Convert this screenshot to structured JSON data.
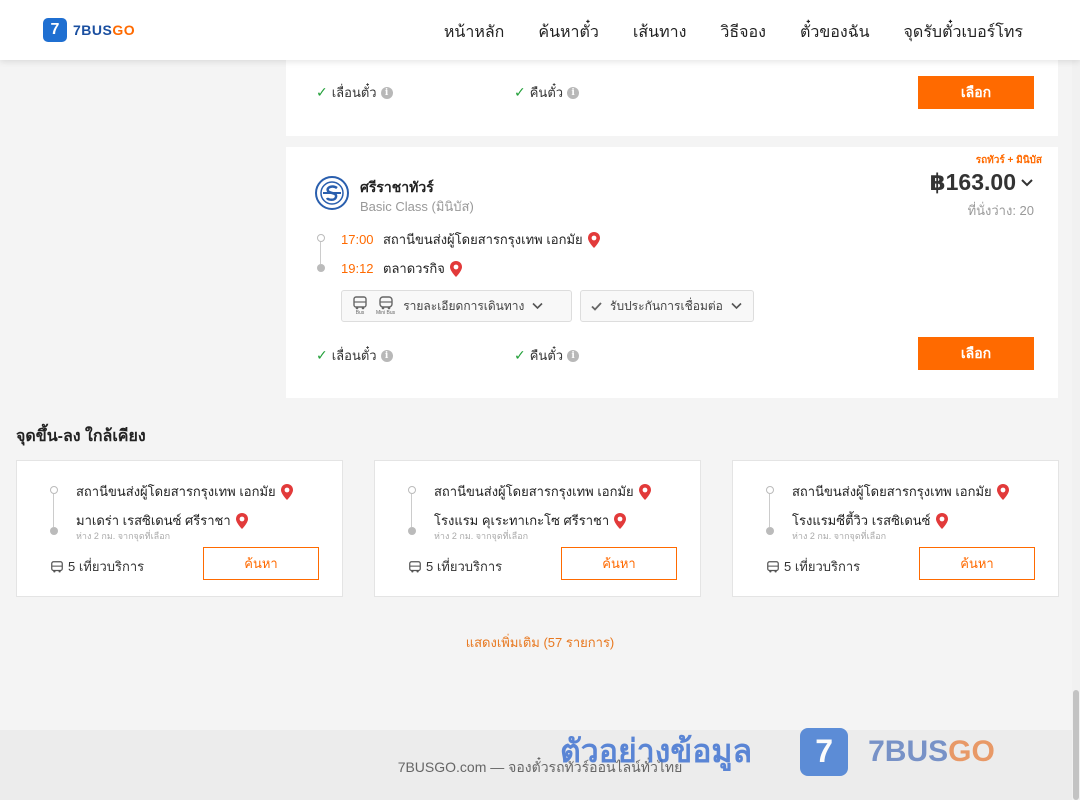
{
  "header": {
    "logo_digit": "7",
    "logo_word1": "7BUS",
    "logo_word2": "GO",
    "nav": [
      "หน้าหลัก",
      "ค้นหาตั๋ว",
      "เส้นทาง",
      "วิธีจอง",
      "ตั๋วของฉัน",
      "จุดรับตั๋วเบอร์โทร"
    ]
  },
  "card1": {
    "feature_reschedule": "เลื่อนตั๋ว",
    "feature_refund": "คืนตั๋ว",
    "select_label": "เลือก"
  },
  "card2": {
    "tag": "รถทัวร์ + มินิบัส",
    "operator": "ศรีราชาทัวร์",
    "class": "Basic Class (มินิบัส)",
    "price": "฿163.00",
    "seats": "ที่นั่งว่าง: 20",
    "depart_time": "17:00",
    "depart_station": "สถานีขนส่งผู้โดยสารกรุงเทพ เอกมัย",
    "arrive_time": "19:12",
    "arrive_station": "ตลาดวรกิจ",
    "bus_label": "Bus",
    "minibus_label": "Mini Bus",
    "details_label": "รายละเอียดการเดินทาง",
    "guarantee_label": "รับประกันการเชื่อมต่อ",
    "feature_reschedule": "เลื่อนตั๋ว",
    "feature_refund": "คืนตั๋ว",
    "select_label": "เลือก"
  },
  "nearby": {
    "title": "จุดขึ้น-ลง ใกล้เคียง",
    "cards": [
      {
        "from": "สถานีขนส่งผู้โดยสารกรุงเทพ เอกมัย",
        "to": "มาเดร่า เรสซิเดนซ์ ศรีราชา",
        "distance": "ห่าง 2 กม. จากจุดที่เลือก",
        "trips": "5 เที่ยวบริการ",
        "button": "ค้นหา"
      },
      {
        "from": "สถานีขนส่งผู้โดยสารกรุงเทพ เอกมัย",
        "to": "โรงแรม คุเระทาเกะโซ ศรีราชา",
        "distance": "ห่าง 2 กม. จากจุดที่เลือก",
        "trips": "5 เที่ยวบริการ",
        "button": "ค้นหา"
      },
      {
        "from": "สถานีขนส่งผู้โดยสารกรุงเทพ เอกมัย",
        "to": "โรงแรมซีตี้วิว เรสซิเดนซ์",
        "distance": "ห่าง 2 กม. จากจุดที่เลือก",
        "trips": "5 เที่ยวบริการ",
        "button": "ค้นหา"
      }
    ],
    "show_more": "แสดงเพิ่มเติม (57 รายการ)"
  },
  "footer": {
    "text": "7BUSGO.com — จองตั๋วรถทัวร์ออนไลน์ทั่วไทย",
    "watermark_thai": "ตัวอย่างข้อมูล",
    "watermark_digit": "7",
    "watermark_word1": "7BUS",
    "watermark_word2": "GO"
  },
  "colors": {
    "accent": "#ff6a00",
    "brand_blue": "#1f6fd1",
    "check_green": "#23a03a",
    "pin_red": "#e23a3a"
  },
  "icons": [
    "check-icon",
    "info-icon",
    "map-pin-icon",
    "bus-icon",
    "minibus-icon",
    "chevron-down-icon",
    "operator-logo"
  ]
}
